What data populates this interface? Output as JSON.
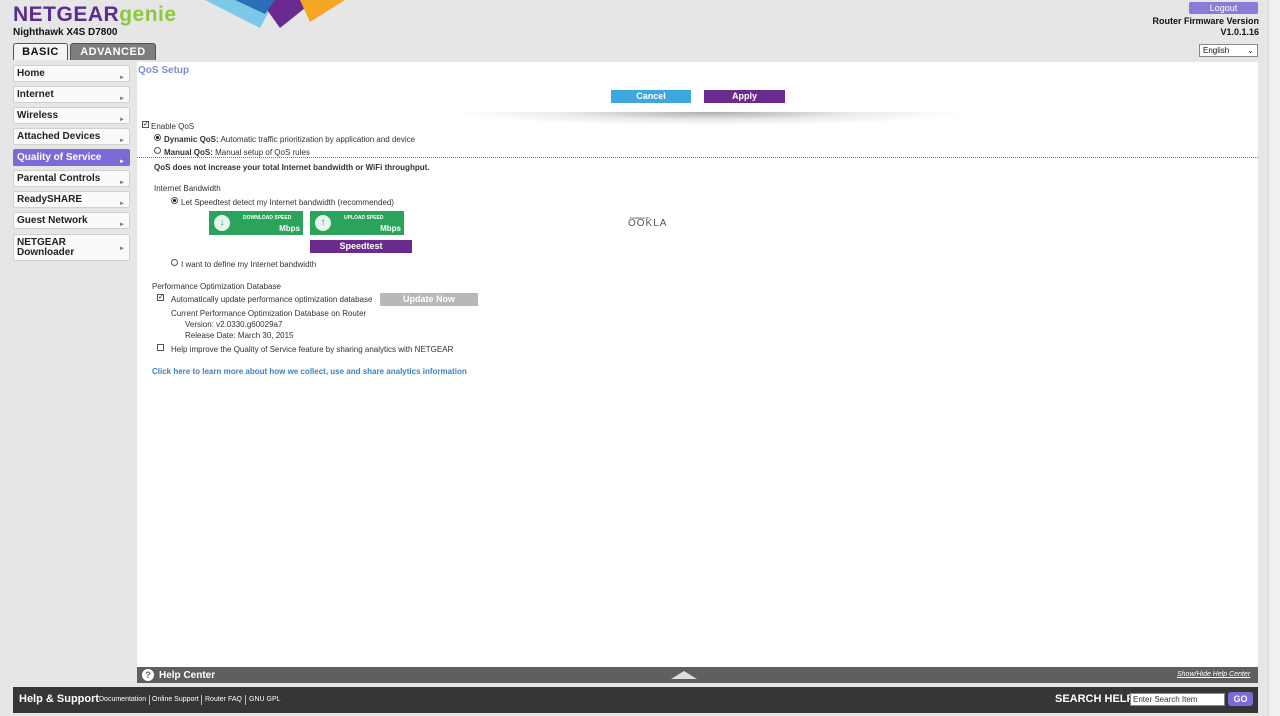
{
  "header": {
    "brand_netgear": "NETGEAR",
    "brand_genie": "genie",
    "model": "Nighthawk X4S D7800",
    "tabs": [
      {
        "label": "BASIC"
      },
      {
        "label": "ADVANCED"
      }
    ],
    "logout_label": "Logout",
    "firmware_label": "Router Firmware Version",
    "firmware_version": "V1.0.1.16",
    "language_selected": "English",
    "colors": {
      "brand_purple": "#5c2d91",
      "brand_green": "#8dc63f"
    }
  },
  "sidebar": {
    "items": [
      {
        "label": "Home"
      },
      {
        "label": "Internet"
      },
      {
        "label": "Wireless"
      },
      {
        "label": "Attached Devices"
      },
      {
        "label": "Quality of Service"
      },
      {
        "label": "Parental Controls"
      },
      {
        "label": "ReadySHARE"
      },
      {
        "label": "Guest Network"
      },
      {
        "label": "NETGEAR Downloader"
      }
    ],
    "active_color": "#7a6bd6"
  },
  "main": {
    "title": "QoS Setup",
    "cancel_label": "Cancel",
    "apply_label": "Apply",
    "enable_qos_label": "Enable QoS",
    "dynamic_qos_title": "Dynamic QoS:",
    "dynamic_qos_desc": "Automatic traffic prioritization by application and device",
    "manual_qos_title": "Manual QoS:",
    "manual_qos_desc": "Manual setup of QoS rules",
    "notice": "QoS does not increase your total Internet bandwidth or WiFi throughput.",
    "bandwidth_heading": "Internet Bandwidth",
    "speedtest_option": "Let Speedtest detect my Internet bandwidth (recommended)",
    "download_label": "DOWNLOAD SPEED",
    "upload_label": "UPLOAD SPEED",
    "unit": "Mbps",
    "speedtest_button": "Speedtest",
    "ookla_small": "POWERED BY",
    "ookla": "OOKLA",
    "define_option": "I want to define my Internet bandwidth",
    "perf_db_heading": "Performance Optimization Database",
    "auto_update_label": "Automatically update performance optimization database",
    "update_now_label": "Update Now",
    "current_db_label": "Current Performance Optimization Database on Router",
    "db_version": "Version: v2.0330.g60029a7",
    "db_release": "Release Date: March 30, 2015",
    "analytics_label": "Help improve the Quality of Service feature by sharing analytics with NETGEAR",
    "learn_more_link": "Click here to learn more about how we collect, use and share analytics information"
  },
  "help_center": {
    "title": "Help Center",
    "toggle": "Show/Hide Help Center"
  },
  "footer": {
    "title": "Help & Support",
    "links": [
      "Documentation",
      "Online Support",
      "Router FAQ",
      "GNU GPL"
    ],
    "search_label": "SEARCH HELP",
    "search_placeholder": "Enter Search Item",
    "go_label": "GO"
  }
}
